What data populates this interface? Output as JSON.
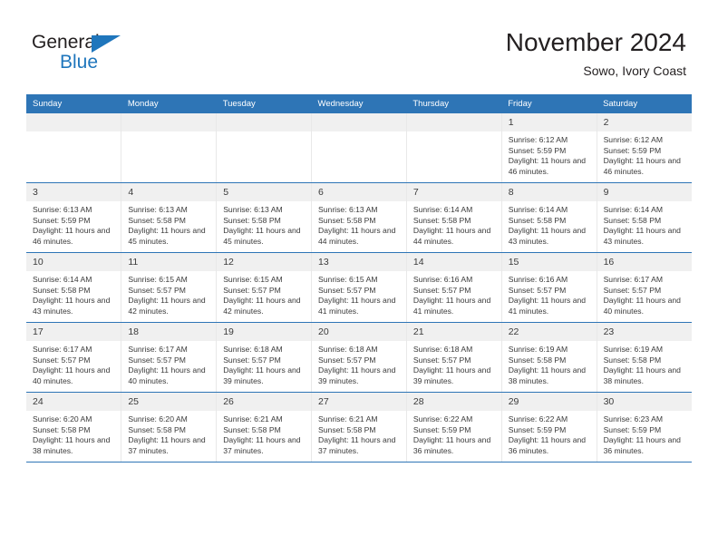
{
  "brand": {
    "logo_text_top": "General",
    "logo_text_bottom": "Blue",
    "logo_icon": "blue-triangle-icon",
    "dark_color": "#231f20",
    "accent_color": "#1f76bc"
  },
  "header": {
    "title": "November 2024",
    "subtitle": "Sowo, Ivory Coast"
  },
  "theme": {
    "header_row_bg": "#2e75b6",
    "daynum_bg": "#f0f0f0",
    "row_divider": "#2e75b6",
    "text": "#3a3a3a"
  },
  "calendar": {
    "weekday_headers": [
      "Sunday",
      "Monday",
      "Tuesday",
      "Wednesday",
      "Thursday",
      "Friday",
      "Saturday"
    ],
    "labels": {
      "sunrise": "Sunrise:",
      "sunset": "Sunset:",
      "daylight": "Daylight:"
    },
    "weeks": [
      [
        {
          "day": "",
          "sunrise": "",
          "sunset": "",
          "daylight": ""
        },
        {
          "day": "",
          "sunrise": "",
          "sunset": "",
          "daylight": ""
        },
        {
          "day": "",
          "sunrise": "",
          "sunset": "",
          "daylight": ""
        },
        {
          "day": "",
          "sunrise": "",
          "sunset": "",
          "daylight": ""
        },
        {
          "day": "",
          "sunrise": "",
          "sunset": "",
          "daylight": ""
        },
        {
          "day": "1",
          "sunrise": "Sunrise: 6:12 AM",
          "sunset": "Sunset: 5:59 PM",
          "daylight": "Daylight: 11 hours and 46 minutes."
        },
        {
          "day": "2",
          "sunrise": "Sunrise: 6:12 AM",
          "sunset": "Sunset: 5:59 PM",
          "daylight": "Daylight: 11 hours and 46 minutes."
        }
      ],
      [
        {
          "day": "3",
          "sunrise": "Sunrise: 6:13 AM",
          "sunset": "Sunset: 5:59 PM",
          "daylight": "Daylight: 11 hours and 46 minutes."
        },
        {
          "day": "4",
          "sunrise": "Sunrise: 6:13 AM",
          "sunset": "Sunset: 5:58 PM",
          "daylight": "Daylight: 11 hours and 45 minutes."
        },
        {
          "day": "5",
          "sunrise": "Sunrise: 6:13 AM",
          "sunset": "Sunset: 5:58 PM",
          "daylight": "Daylight: 11 hours and 45 minutes."
        },
        {
          "day": "6",
          "sunrise": "Sunrise: 6:13 AM",
          "sunset": "Sunset: 5:58 PM",
          "daylight": "Daylight: 11 hours and 44 minutes."
        },
        {
          "day": "7",
          "sunrise": "Sunrise: 6:14 AM",
          "sunset": "Sunset: 5:58 PM",
          "daylight": "Daylight: 11 hours and 44 minutes."
        },
        {
          "day": "8",
          "sunrise": "Sunrise: 6:14 AM",
          "sunset": "Sunset: 5:58 PM",
          "daylight": "Daylight: 11 hours and 43 minutes."
        },
        {
          "day": "9",
          "sunrise": "Sunrise: 6:14 AM",
          "sunset": "Sunset: 5:58 PM",
          "daylight": "Daylight: 11 hours and 43 minutes."
        }
      ],
      [
        {
          "day": "10",
          "sunrise": "Sunrise: 6:14 AM",
          "sunset": "Sunset: 5:58 PM",
          "daylight": "Daylight: 11 hours and 43 minutes."
        },
        {
          "day": "11",
          "sunrise": "Sunrise: 6:15 AM",
          "sunset": "Sunset: 5:57 PM",
          "daylight": "Daylight: 11 hours and 42 minutes."
        },
        {
          "day": "12",
          "sunrise": "Sunrise: 6:15 AM",
          "sunset": "Sunset: 5:57 PM",
          "daylight": "Daylight: 11 hours and 42 minutes."
        },
        {
          "day": "13",
          "sunrise": "Sunrise: 6:15 AM",
          "sunset": "Sunset: 5:57 PM",
          "daylight": "Daylight: 11 hours and 41 minutes."
        },
        {
          "day": "14",
          "sunrise": "Sunrise: 6:16 AM",
          "sunset": "Sunset: 5:57 PM",
          "daylight": "Daylight: 11 hours and 41 minutes."
        },
        {
          "day": "15",
          "sunrise": "Sunrise: 6:16 AM",
          "sunset": "Sunset: 5:57 PM",
          "daylight": "Daylight: 11 hours and 41 minutes."
        },
        {
          "day": "16",
          "sunrise": "Sunrise: 6:17 AM",
          "sunset": "Sunset: 5:57 PM",
          "daylight": "Daylight: 11 hours and 40 minutes."
        }
      ],
      [
        {
          "day": "17",
          "sunrise": "Sunrise: 6:17 AM",
          "sunset": "Sunset: 5:57 PM",
          "daylight": "Daylight: 11 hours and 40 minutes."
        },
        {
          "day": "18",
          "sunrise": "Sunrise: 6:17 AM",
          "sunset": "Sunset: 5:57 PM",
          "daylight": "Daylight: 11 hours and 40 minutes."
        },
        {
          "day": "19",
          "sunrise": "Sunrise: 6:18 AM",
          "sunset": "Sunset: 5:57 PM",
          "daylight": "Daylight: 11 hours and 39 minutes."
        },
        {
          "day": "20",
          "sunrise": "Sunrise: 6:18 AM",
          "sunset": "Sunset: 5:57 PM",
          "daylight": "Daylight: 11 hours and 39 minutes."
        },
        {
          "day": "21",
          "sunrise": "Sunrise: 6:18 AM",
          "sunset": "Sunset: 5:57 PM",
          "daylight": "Daylight: 11 hours and 39 minutes."
        },
        {
          "day": "22",
          "sunrise": "Sunrise: 6:19 AM",
          "sunset": "Sunset: 5:58 PM",
          "daylight": "Daylight: 11 hours and 38 minutes."
        },
        {
          "day": "23",
          "sunrise": "Sunrise: 6:19 AM",
          "sunset": "Sunset: 5:58 PM",
          "daylight": "Daylight: 11 hours and 38 minutes."
        }
      ],
      [
        {
          "day": "24",
          "sunrise": "Sunrise: 6:20 AM",
          "sunset": "Sunset: 5:58 PM",
          "daylight": "Daylight: 11 hours and 38 minutes."
        },
        {
          "day": "25",
          "sunrise": "Sunrise: 6:20 AM",
          "sunset": "Sunset: 5:58 PM",
          "daylight": "Daylight: 11 hours and 37 minutes."
        },
        {
          "day": "26",
          "sunrise": "Sunrise: 6:21 AM",
          "sunset": "Sunset: 5:58 PM",
          "daylight": "Daylight: 11 hours and 37 minutes."
        },
        {
          "day": "27",
          "sunrise": "Sunrise: 6:21 AM",
          "sunset": "Sunset: 5:58 PM",
          "daylight": "Daylight: 11 hours and 37 minutes."
        },
        {
          "day": "28",
          "sunrise": "Sunrise: 6:22 AM",
          "sunset": "Sunset: 5:59 PM",
          "daylight": "Daylight: 11 hours and 36 minutes."
        },
        {
          "day": "29",
          "sunrise": "Sunrise: 6:22 AM",
          "sunset": "Sunset: 5:59 PM",
          "daylight": "Daylight: 11 hours and 36 minutes."
        },
        {
          "day": "30",
          "sunrise": "Sunrise: 6:23 AM",
          "sunset": "Sunset: 5:59 PM",
          "daylight": "Daylight: 11 hours and 36 minutes."
        }
      ]
    ]
  }
}
